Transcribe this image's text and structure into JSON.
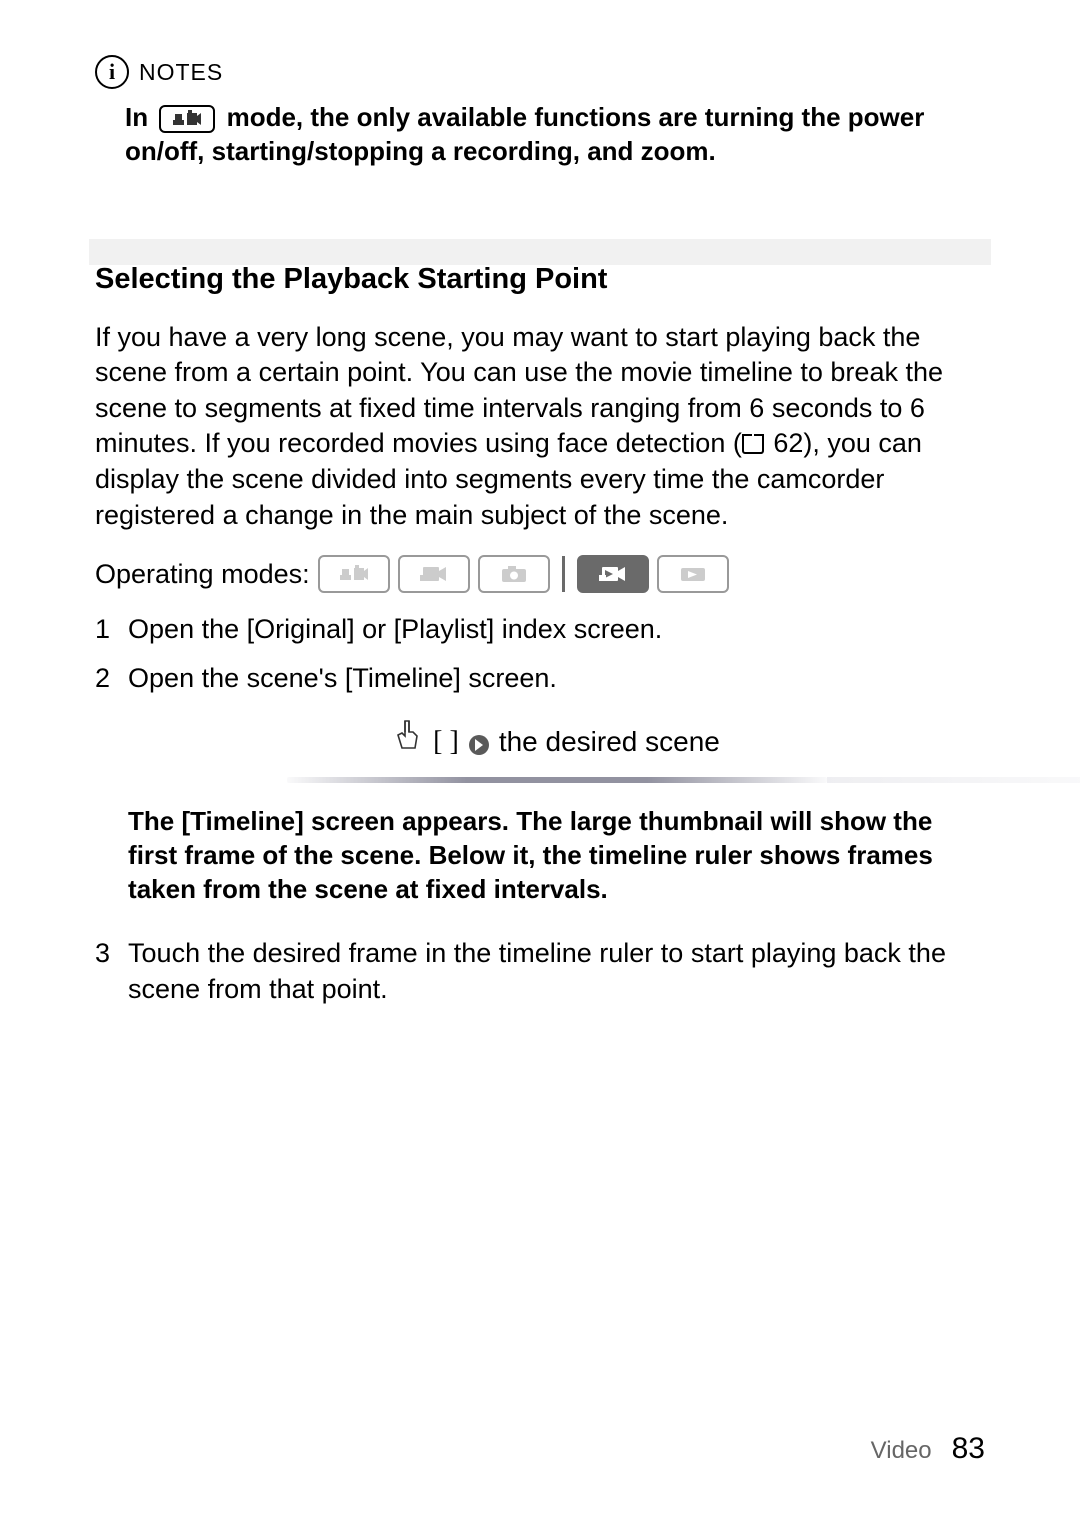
{
  "notes": {
    "icon_char": "i",
    "label": "NOTES",
    "body_prefix": "In",
    "body_rest": " mode, the only available functions are turning the power on/off, starting/stopping a recording, and zoom."
  },
  "section": {
    "heading": "Selecting the Playback Starting Point",
    "intro_part1": "If you have a very long scene, you may want to start playing back the scene from a certain point. You can use the movie timeline to break the scene to segments at fixed time intervals ranging from 6 seconds to 6 minutes. If you recorded movies using face detection (",
    "cross_ref": " 62",
    "intro_part2": "), you can display the scene divided into segments every time the camcorder registered a change in the main subject of the scene.",
    "operating_modes_label": "Operating modes:"
  },
  "steps": {
    "item1": "Open the [Original] or [Playlist] index screen.",
    "item2": "Open the scene's [Timeline] screen.",
    "touch_brackets": "[  ]",
    "touch_label": "the desired scene",
    "step2_note": "The [Timeline] screen appears. The large thumbnail will show the first frame of the scene. Below it, the timeline ruler shows frames taken from the scene at fixed intervals.",
    "item3": "Touch the desired frame in the timeline ruler to start playing back the scene from that point."
  },
  "footer": {
    "section_name": "Video",
    "page_number": "83"
  }
}
